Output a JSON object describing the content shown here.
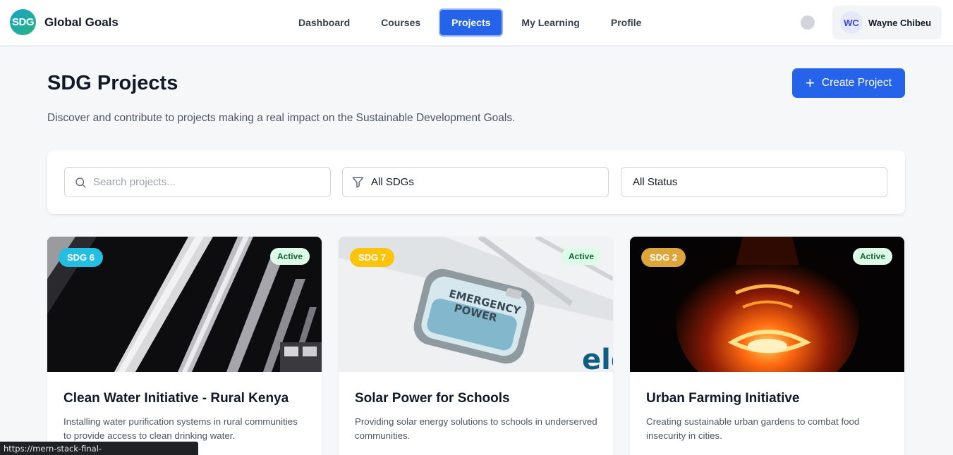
{
  "header": {
    "logo_text": "SDG",
    "brand": "Global Goals",
    "nav": [
      {
        "label": "Dashboard",
        "active": false
      },
      {
        "label": "Courses",
        "active": false
      },
      {
        "label": "Projects",
        "active": true
      },
      {
        "label": "My Learning",
        "active": false
      },
      {
        "label": "Profile",
        "active": false
      }
    ],
    "user": {
      "initials": "WC",
      "name": "Wayne Chibeu"
    }
  },
  "page": {
    "title": "SDG Projects",
    "subtitle": "Discover and contribute to projects making a real impact on the Sustainable Development Goals.",
    "create_button": "Create Project",
    "create_icon": "+"
  },
  "filters": {
    "search_placeholder": "Search projects...",
    "sdg_value": "All SDGs",
    "status_value": "All Status"
  },
  "projects": [
    {
      "sdg": "SDG 6",
      "sdg_color": "#26bde2",
      "status": "Active",
      "title": "Clean Water Initiative - Rural Kenya",
      "description": "Installing water purification systems in rural communities to provide access to clean drinking water."
    },
    {
      "sdg": "SDG 7",
      "sdg_color": "#fcc30b",
      "status": "Active",
      "title": "Solar Power for Schools",
      "description": "Providing solar energy solutions to schools in underserved communities."
    },
    {
      "sdg": "SDG 2",
      "sdg_color": "#dda63a",
      "status": "Active",
      "title": "Urban Farming Initiative",
      "description": "Creating sustainable urban gardens to combat food insecurity in cities."
    }
  ],
  "images": {
    "sign_line1": "EMERGENCY",
    "sign_line2": "POWER",
    "panel_text": "ele"
  },
  "statusbar": {
    "url": "https://mern-stack-final-project.vercel.app/projects"
  },
  "colors": {
    "primary": "#2563eb",
    "status_bg": "#dcfce7",
    "status_text": "#166534"
  }
}
